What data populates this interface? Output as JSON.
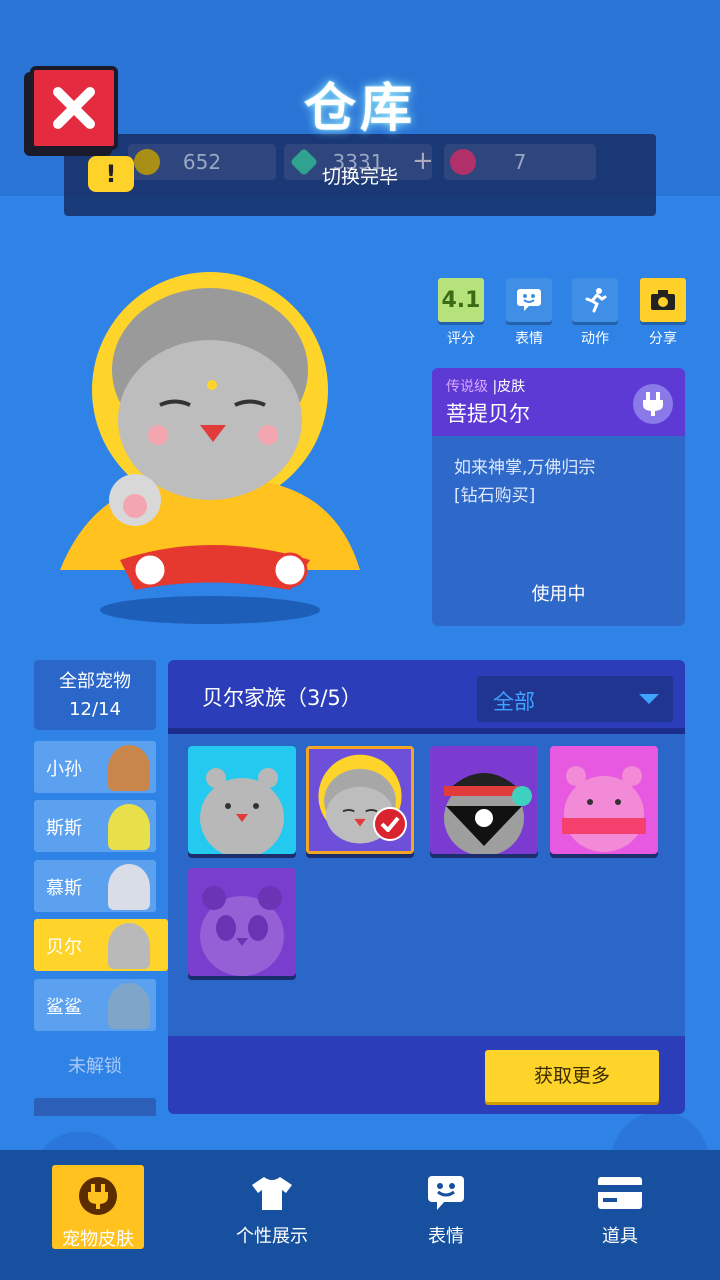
{
  "header": {
    "title": "仓库",
    "close_icon": "close-icon"
  },
  "currency": {
    "gold": "652",
    "gems": "3331",
    "plus": "+",
    "lotus": "7"
  },
  "toast": {
    "text": "切换完毕",
    "icon": "!"
  },
  "actions": {
    "rating_value": "4.1",
    "rating_label": "评分",
    "emote_label": "表情",
    "move_label": "动作",
    "share_label": "分享"
  },
  "skin_info": {
    "tier": "传说级",
    "sep": "|",
    "type": "皮肤",
    "name": "菩提贝尔",
    "desc_line1": "如来神掌,万佛归宗",
    "desc_line2": "[钻石购买]",
    "status": "使用中"
  },
  "sidebar": {
    "all_label": "全部宠物",
    "count": "12/14",
    "items": [
      {
        "label": "小孙"
      },
      {
        "label": "斯斯"
      },
      {
        "label": "慕斯"
      },
      {
        "label": "贝尔"
      },
      {
        "label": "鲨鲨"
      }
    ],
    "locked_label": "未解锁"
  },
  "panel": {
    "family_title": "贝尔家族（3/5）",
    "filter_value": "全部",
    "get_more": "获取更多"
  },
  "bottom_nav": {
    "items": [
      {
        "label": "宠物皮肤",
        "icon": "plug-icon"
      },
      {
        "label": "个性展示",
        "icon": "tshirt-icon"
      },
      {
        "label": "表情",
        "icon": "emote-icon"
      },
      {
        "label": "道具",
        "icon": "card-icon"
      }
    ]
  },
  "colors": {
    "background": "#2f82e6",
    "accent_yellow": "#ffd42a",
    "close_red": "#e52b3f",
    "legend_purple": "#5d3ad4"
  }
}
